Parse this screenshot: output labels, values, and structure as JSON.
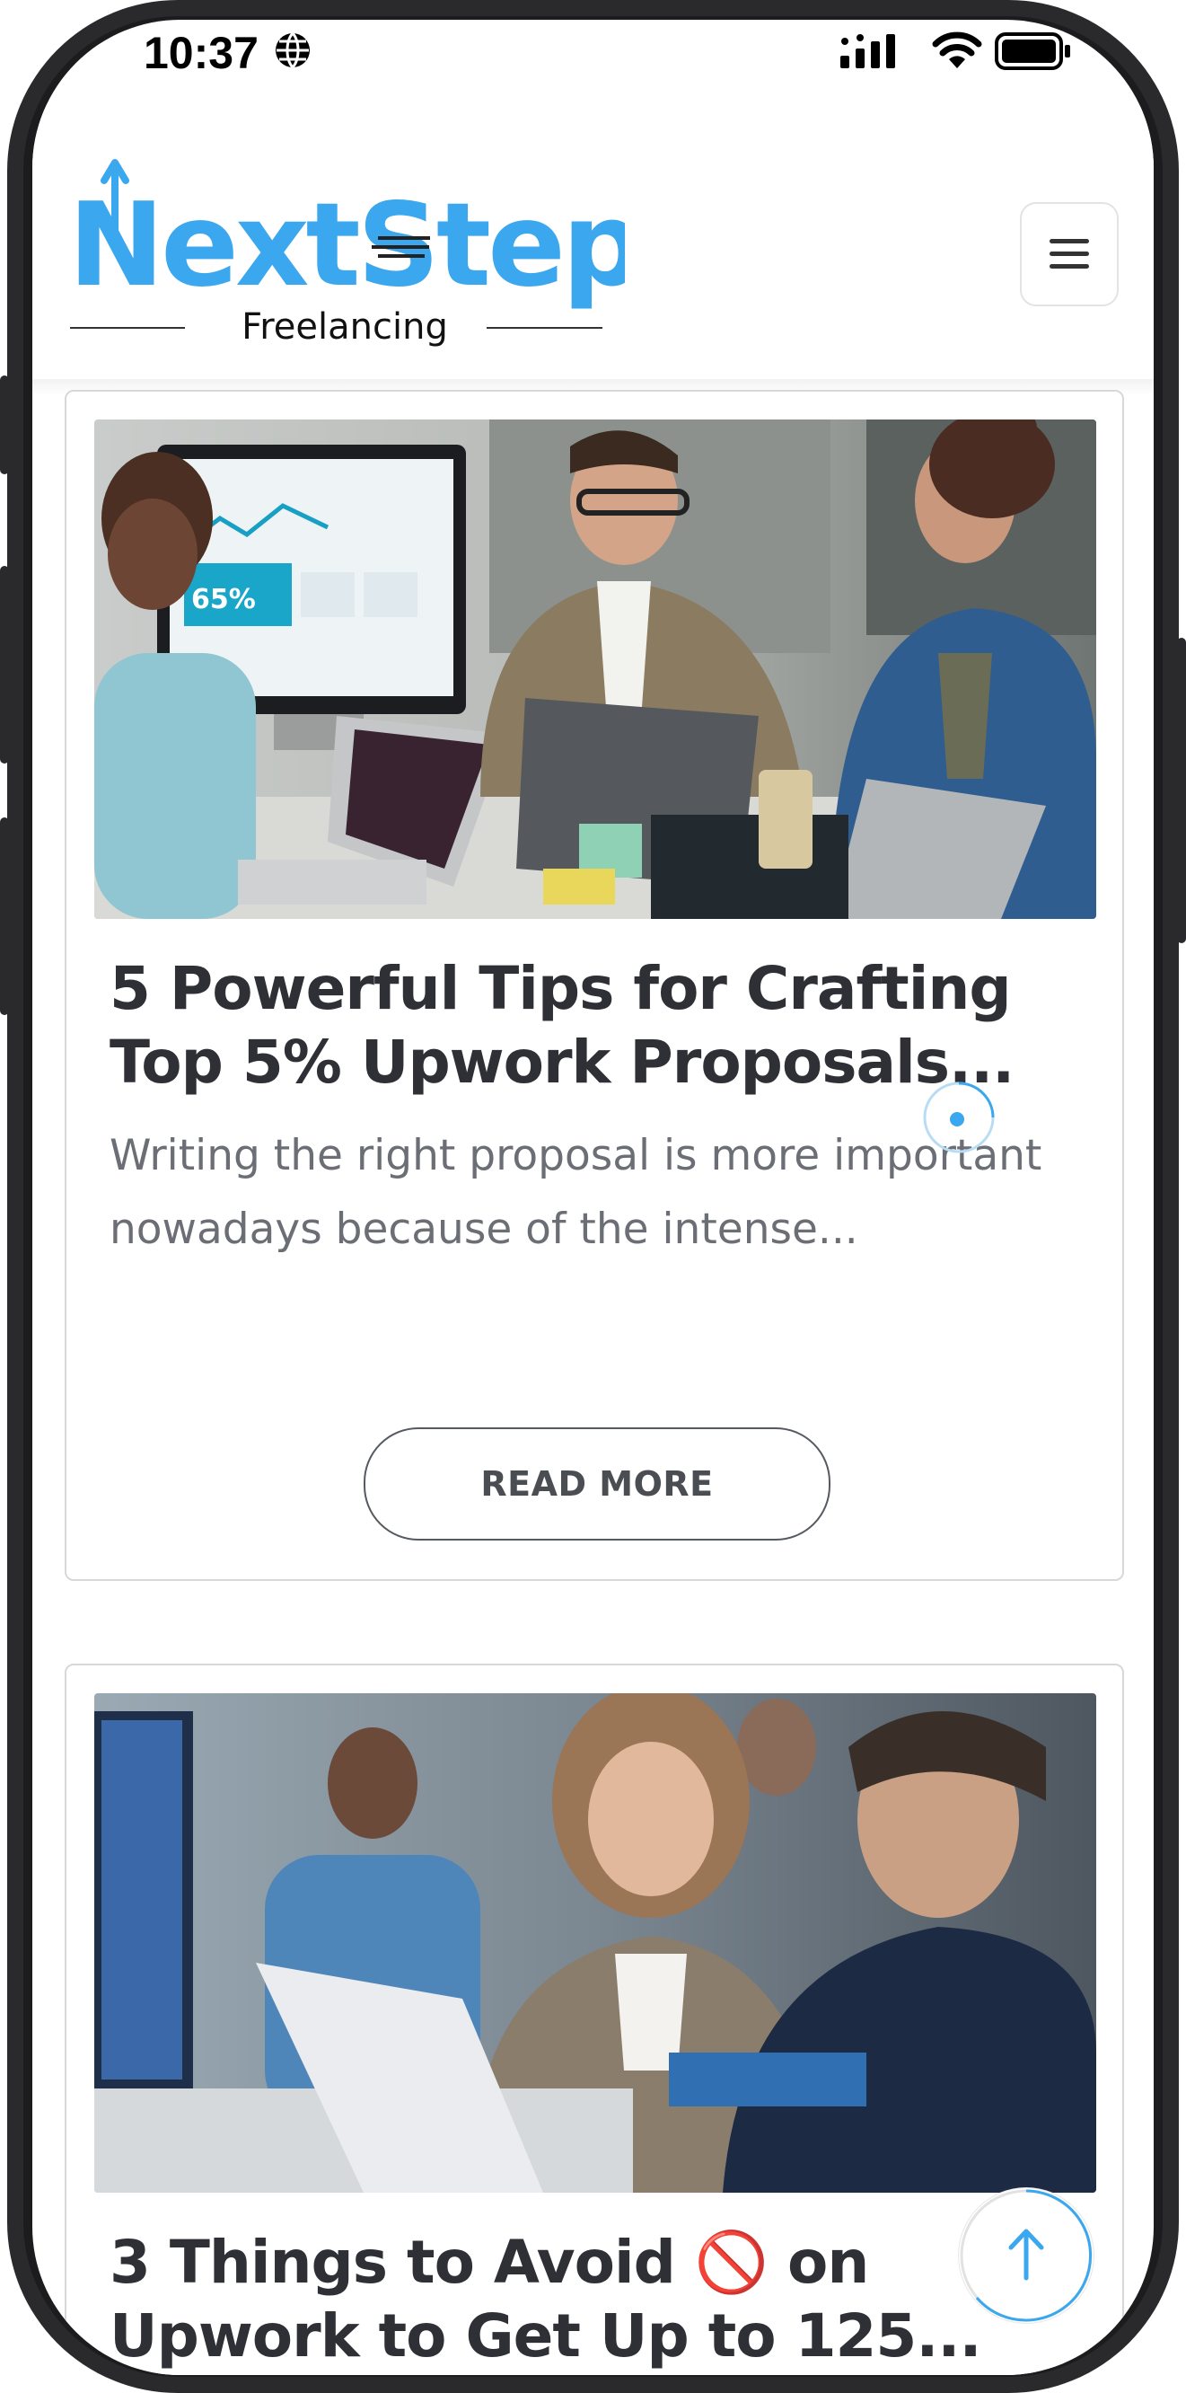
{
  "status_bar": {
    "time": "10:37"
  },
  "header": {
    "logo_main": "NextStep",
    "logo_sub": "Freelancing",
    "brand_color": "#3aa7ee",
    "menu_icon": "hamburger-icon"
  },
  "posts": [
    {
      "title": "5 Powerful Tips for Crafting Top 5% Upwork Proposals...",
      "excerpt": "Writing the right proposal is more important nowadays because of the intense...",
      "button": "READ MORE",
      "image": "team-meeting-photo"
    },
    {
      "title": "3 Things to Avoid 🚫 on Upwork to Get Up to 125...",
      "image": "business-meeting-photo"
    }
  ],
  "scroll_top_icon": "arrow-up-icon"
}
